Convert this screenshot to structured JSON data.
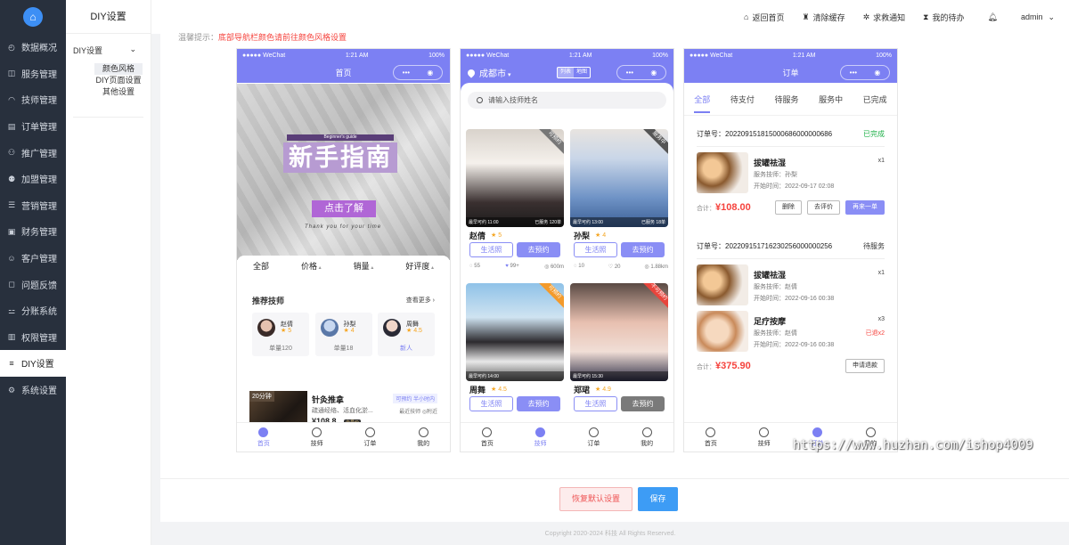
{
  "sidebar": {
    "logo_icon": "home-icon",
    "items": [
      {
        "label": "数据概况",
        "icon": "dashboard-icon"
      },
      {
        "label": "服务管理",
        "icon": "service-icon"
      },
      {
        "label": "技师管理",
        "icon": "technician-icon"
      },
      {
        "label": "订单管理",
        "icon": "order-icon"
      },
      {
        "label": "推广管理",
        "icon": "promotion-icon"
      },
      {
        "label": "加盟管理",
        "icon": "franchise-icon"
      },
      {
        "label": "营销管理",
        "icon": "marketing-icon"
      },
      {
        "label": "财务管理",
        "icon": "finance-icon"
      },
      {
        "label": "客户管理",
        "icon": "customer-icon"
      },
      {
        "label": "问题反馈",
        "icon": "feedback-icon"
      },
      {
        "label": "分账系统",
        "icon": "split-icon"
      },
      {
        "label": "权限管理",
        "icon": "permission-icon"
      },
      {
        "label": "DIY设置",
        "icon": "diy-icon",
        "active": true
      },
      {
        "label": "系统设置",
        "icon": "gear-icon"
      }
    ]
  },
  "subnav": {
    "title": "DIY设置",
    "group": "DIY设置",
    "items": [
      "颜色风格",
      "DIY页面设置",
      "其他设置"
    ]
  },
  "topbar": {
    "items": [
      {
        "label": "返回首页",
        "icon": "home-icon"
      },
      {
        "label": "清除缓存",
        "icon": "broom-icon"
      },
      {
        "label": "求救通知",
        "icon": "alert-icon"
      },
      {
        "label": "我的待办",
        "icon": "hourglass-icon"
      }
    ],
    "bell_icon": "bell-icon",
    "user": "admin"
  },
  "hint": {
    "prefix": "温馨提示：",
    "text": "底部导航栏颜色请前往颜色风格设置"
  },
  "status": {
    "carrier": "●●●●● WeChat",
    "time": "1:21 AM",
    "battery": "100%"
  },
  "phone1": {
    "nav_title": "首页",
    "banner": {
      "tag": "Beginner's guide",
      "title": "新手指南",
      "button": "点击了解",
      "thanks": "Thank you for your time"
    },
    "filters": [
      "全部",
      "价格",
      "销量",
      "好评度"
    ],
    "section_title": "推荐技师",
    "more": "查看更多",
    "techs": [
      {
        "name": "赵倩",
        "rating": "★ 5",
        "count": "单量120"
      },
      {
        "name": "孙梨",
        "rating": "★ 4",
        "count": "单量18"
      },
      {
        "name": "周舞",
        "rating": "★ 4.5",
        "count": "新人",
        "is_new": true
      }
    ],
    "service": {
      "badge": "20分钟",
      "name": "针灸推拿",
      "bookable": "可预约 半小时内",
      "desc": "疏通经络、活血化淤...",
      "nearby": "最近技师 ◎附近",
      "price": "¥108.8",
      "member": "会员价"
    }
  },
  "phone2": {
    "city": "成都市",
    "modes": [
      "列表",
      "地图"
    ],
    "search_placeholder": "请输入技师姓名",
    "cards": [
      {
        "name": "赵倩",
        "rating": "★ 5",
        "ribbon": "可预约",
        "time": "最早可约 11:00",
        "served": "已服务 120单",
        "btn1": "生活照",
        "btn2": "去预约",
        "stats": [
          "55",
          "99+",
          "600m"
        ]
      },
      {
        "name": "孙梨",
        "rating": "★ 4",
        "ribbon": "服务中",
        "time": "最早可约 13:00",
        "served": "已服务 18单",
        "btn1": "生活照",
        "btn2": "去预约",
        "stats": [
          "10",
          "20",
          "1.88km"
        ]
      },
      {
        "name": "周舞",
        "rating": "★ 4.5",
        "ribbon": "可预约",
        "time": "最早可约 14:00",
        "served": "",
        "btn1": "生活照",
        "btn2": "去预约",
        "stats": []
      },
      {
        "name": "郑珺",
        "rating": "★ 4.9",
        "ribbon": "不可预约",
        "time": "最早可约 15:30",
        "served": "",
        "btn1": "生活照",
        "btn2": "去预约",
        "stats": [],
        "disabled": true
      }
    ]
  },
  "phone3": {
    "nav_title": "订单",
    "tabs": [
      "全部",
      "待支付",
      "待服务",
      "服务中",
      "已完成"
    ],
    "orders": [
      {
        "no": "订单号：202209151815000686000000686",
        "status": "已完成",
        "items": [
          {
            "name": "拔罐祛湿",
            "qty": "x1",
            "tech": "服务技师：孙梨",
            "start": "开始时间：2022-09-17 02:08",
            "refund": ""
          }
        ],
        "total_label": "合计：",
        "total": "¥108.00",
        "buttons": [
          "删除",
          "去评价",
          "再来一单"
        ]
      },
      {
        "no": "订单号：202209151716230256000000256",
        "status": "待服务",
        "items": [
          {
            "name": "拔罐祛湿",
            "qty": "x1",
            "tech": "服务技师：赵倩",
            "start": "开始时间：2022-09-16 00:38",
            "refund": ""
          },
          {
            "name": "足疗按摩",
            "qty": "x3",
            "tech": "服务技师：赵倩",
            "start": "开始时间：2022-09-16 00:38",
            "refund": "已退x2"
          }
        ],
        "total_label": "合计：",
        "total": "¥375.90",
        "buttons": [
          "申请退款"
        ]
      }
    ]
  },
  "tabbar1": [
    "首页",
    "技师",
    "订单",
    "我的"
  ],
  "actions": {
    "reset": "恢复默认设置",
    "save": "保存"
  },
  "footer": "Copyright 2020-2024 科技 All Rights Reserved.",
  "watermark": "https://www.huzhan.com/ishop4009",
  "colors": {
    "theme": "#7c80f3",
    "sidebar": "#28303d",
    "save": "#3d9cf5",
    "price": "#f5433d",
    "done": "#20b14a",
    "rating": "#f5a623"
  }
}
